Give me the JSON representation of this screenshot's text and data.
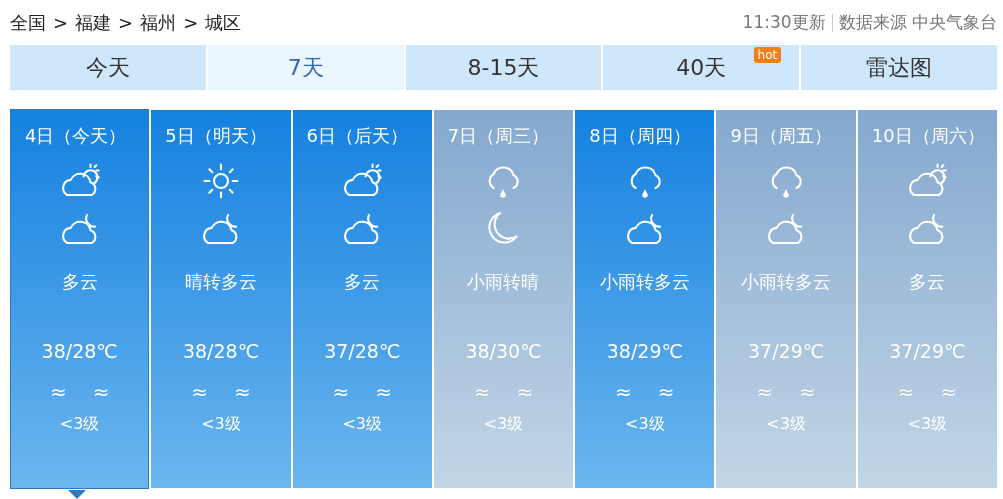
{
  "breadcrumb": [
    {
      "label": "全国"
    },
    {
      "label": "福建"
    },
    {
      "label": "福州"
    },
    {
      "label": "城区"
    }
  ],
  "breadcrumb_separator": ">",
  "update_time": "11:30更新",
  "source": "数据来源 中央气象台",
  "tabs": [
    {
      "label": "今天",
      "selected": false
    },
    {
      "label": "7天",
      "selected": true
    },
    {
      "label": "8-15天",
      "selected": false
    },
    {
      "label": "40天",
      "selected": false,
      "badge": "hot"
    },
    {
      "label": "雷达图",
      "selected": false
    }
  ],
  "days": [
    {
      "date": "4日（今天）",
      "icons": [
        {
          "kind": "partly-cloudy-day"
        },
        {
          "kind": "partly-cloudy-night"
        }
      ],
      "weather": "多云",
      "temp": "38/28℃",
      "wind_day": "≈",
      "wind_night": "≈",
      "wind_level": "<3级",
      "dim": false,
      "selected": true
    },
    {
      "date": "5日（明天）",
      "icons": [
        {
          "kind": "sunny"
        },
        {
          "kind": "partly-cloudy-night"
        }
      ],
      "weather": "晴转多云",
      "temp": "38/28℃",
      "wind_day": "≈",
      "wind_night": "≈",
      "wind_level": "<3级",
      "dim": false,
      "selected": false
    },
    {
      "date": "6日（后天）",
      "icons": [
        {
          "kind": "partly-cloudy-day"
        },
        {
          "kind": "partly-cloudy-night"
        }
      ],
      "weather": "多云",
      "temp": "37/28℃",
      "wind_day": "≈",
      "wind_night": "≈",
      "wind_level": "<3级",
      "dim": false,
      "selected": false
    },
    {
      "date": "7日（周三）",
      "icons": [
        {
          "kind": "rain"
        },
        {
          "kind": "moon"
        }
      ],
      "weather": "小雨转晴",
      "temp": "38/30℃",
      "wind_day": "≈",
      "wind_night": "≈",
      "wind_level": "<3级",
      "dim": true,
      "selected": false
    },
    {
      "date": "8日（周四）",
      "icons": [
        {
          "kind": "rain"
        },
        {
          "kind": "partly-cloudy-night"
        }
      ],
      "weather": "小雨转多云",
      "temp": "38/29℃",
      "wind_day": "≈",
      "wind_night": "≈",
      "wind_level": "<3级",
      "dim": false,
      "selected": false
    },
    {
      "date": "9日（周五）",
      "icons": [
        {
          "kind": "rain"
        },
        {
          "kind": "partly-cloudy-night"
        }
      ],
      "weather": "小雨转多云",
      "temp": "37/29℃",
      "wind_day": "≈",
      "wind_night": "≈",
      "wind_level": "<3级",
      "dim": true,
      "selected": false
    },
    {
      "date": "10日（周六）",
      "icons": [
        {
          "kind": "partly-cloudy-day"
        },
        {
          "kind": "partly-cloudy-night"
        }
      ],
      "weather": "多云",
      "temp": "37/29℃",
      "wind_day": "≈",
      "wind_night": "≈",
      "wind_level": "<3级",
      "dim": true,
      "selected": false
    }
  ]
}
